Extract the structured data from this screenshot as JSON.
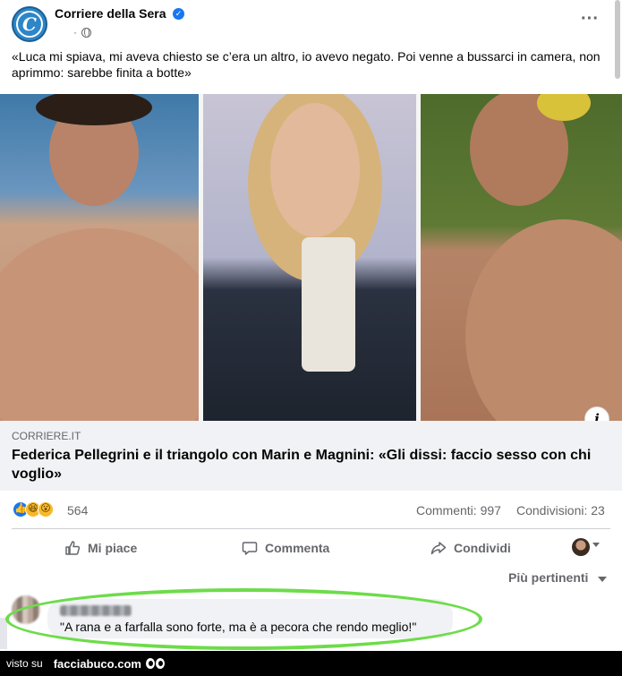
{
  "post": {
    "page_name": "Corriere della Sera",
    "logo_letter": "C",
    "meta_dot": "·",
    "text": "«Luca mi spiava, mi aveva chiesto se c’era un altro, io avevo negato. Poi venne a bussarci in camera, non aprimmo: sarebbe finita a botte»"
  },
  "link": {
    "domain": "CORRIERE.IT",
    "title": "Federica Pellegrini e il triangolo con Marin e Magnini: «Gli dissi: faccio sesso con chi voglio»"
  },
  "stats": {
    "reaction_count": "564",
    "comments": "Commenti: 997",
    "shares": "Condivisioni: 23"
  },
  "actions": {
    "like": "Mi piace",
    "comment": "Commenta",
    "share": "Condividi"
  },
  "comments_sort": "Più pertinenti",
  "comment": {
    "text": "\"A rana e a farfalla sono forte, ma è a pecora che rendo meglio!\""
  },
  "watermark": {
    "prefix": "visto su",
    "site": "facciabuco.com"
  },
  "icons": [
    "verified-icon",
    "globe-icon",
    "more-icon",
    "info-icon",
    "like-icon",
    "comment-icon",
    "share-icon",
    "like-reaction-icon",
    "haha-reaction-icon",
    "wow-reaction-icon"
  ],
  "colors": {
    "accent": "#1877f2",
    "highlight": "#6ddc4a",
    "muted_text": "#65676b",
    "link_box_bg": "#f0f2f5"
  }
}
